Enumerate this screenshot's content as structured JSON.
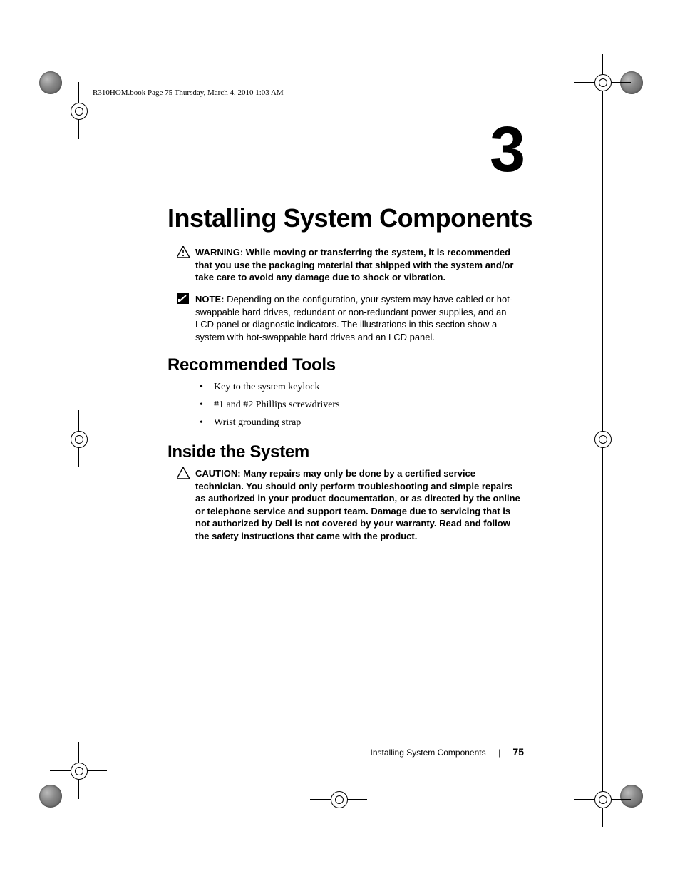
{
  "header_line": "R310HOM.book  Page 75  Thursday, March 4, 2010  1:03 AM",
  "chapter_number": "3",
  "chapter_title": "Installing System Components",
  "warning": {
    "label": "WARNING:",
    "text": " While moving or transferring the system, it is recommended that you use the packaging material that shipped with the system and/or take care to avoid any damage due to shock or vibration."
  },
  "note": {
    "label": "NOTE:",
    "text": " Depending on the configuration, your system may have cabled or hot-swappable hard drives, redundant or non-redundant power supplies, and an LCD panel or diagnostic indicators. The illustrations in this section show a system with hot-swappable hard drives and an LCD panel."
  },
  "section_tools": "Recommended Tools",
  "bullets": [
    "Key to the system keylock",
    "#1 and #2 Phillips screwdrivers",
    "Wrist grounding strap"
  ],
  "section_inside": "Inside the System",
  "caution": {
    "label": "CAUTION:",
    "text": " Many repairs may only be done by a certified service technician. You should only perform troubleshooting and simple repairs as authorized in your product documentation, or as directed by the online or telephone service and support team. Damage due to servicing that is not authorized by Dell is not covered by your warranty. Read and follow the safety instructions that came with the product."
  },
  "footer": {
    "title": "Installing System Components",
    "page": "75"
  }
}
